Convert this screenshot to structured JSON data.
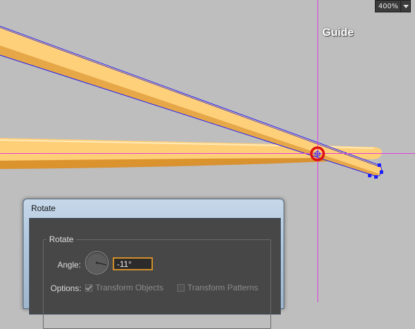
{
  "canvas": {
    "guide_label": "Guide",
    "zoom_value": "400%",
    "colors": {
      "background": "#bebebe",
      "guide": "#e23ce0",
      "stick_fill": "#ffd27e",
      "stick_shadow": "#d98f2a",
      "selection": "#1a1aff",
      "rotate_origin": "#e01010"
    },
    "icons": [
      "rotate-origin-icon",
      "zoom-dropdown-arrow-icon",
      "angle-dial-icon"
    ]
  },
  "dialog": {
    "title": "Rotate",
    "group_label": "Rotate",
    "angle_label": "Angle:",
    "angle_value": "-11°",
    "options_label": "Options:",
    "transform_objects": {
      "label": "Transform Objects",
      "checked": true,
      "enabled": false
    },
    "transform_patterns": {
      "label": "Transform Patterns",
      "checked": false,
      "enabled": false
    }
  }
}
